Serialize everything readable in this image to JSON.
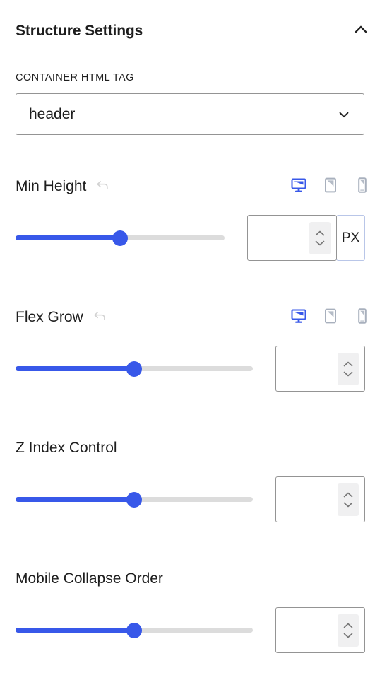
{
  "panel": {
    "title": "Structure Settings",
    "collapse_icon": "chevron-up-icon",
    "accent_color": "#3858e9",
    "track_color": "#dcdcdc",
    "border_color": "#949494",
    "text_color": "#1e1e1e"
  },
  "html_tag_field": {
    "label": "CONTAINER HTML TAG",
    "value": "header",
    "placeholder": "",
    "chevron_icon": "chevron-down-icon",
    "options": [
      "header"
    ]
  },
  "controls": [
    {
      "key": "min_height",
      "label": "Min Height",
      "has_reset": true,
      "reset_icon": "undo-arrow-icon",
      "has_devices": true,
      "slider": {
        "percent": 50,
        "value": ""
      },
      "input": {
        "value": "",
        "placeholder": ""
      },
      "spinner_icons": [
        "chevron-up-icon",
        "chevron-down-icon"
      ],
      "unit": "PX"
    },
    {
      "key": "flex_grow",
      "label": "Flex Grow",
      "has_reset": true,
      "reset_icon": "undo-arrow-icon",
      "has_devices": true,
      "slider": {
        "percent": 50,
        "value": ""
      },
      "input": {
        "value": "",
        "placeholder": ""
      },
      "spinner_icons": [
        "chevron-up-icon",
        "chevron-down-icon"
      ],
      "unit": null
    },
    {
      "key": "z_index",
      "label": "Z Index Control",
      "has_reset": false,
      "has_devices": false,
      "slider": {
        "percent": 50,
        "value": ""
      },
      "input": {
        "value": "",
        "placeholder": ""
      },
      "spinner_icons": [
        "chevron-up-icon",
        "chevron-down-icon"
      ],
      "unit": null
    },
    {
      "key": "mobile_collapse_order",
      "label": "Mobile Collapse Order",
      "has_reset": false,
      "has_devices": false,
      "slider": {
        "percent": 50,
        "value": ""
      },
      "input": {
        "value": "",
        "placeholder": ""
      },
      "spinner_icons": [
        "chevron-up-icon",
        "chevron-down-icon"
      ],
      "unit": null
    }
  ],
  "devices": [
    {
      "name": "desktop",
      "icon": "desktop-icon",
      "active": true,
      "color": "#3858e9"
    },
    {
      "name": "tablet",
      "icon": "tablet-icon",
      "active": false,
      "color": "#a8b0bd"
    },
    {
      "name": "mobile",
      "icon": "mobile-icon",
      "active": false,
      "color": "#a8b0bd"
    }
  ]
}
